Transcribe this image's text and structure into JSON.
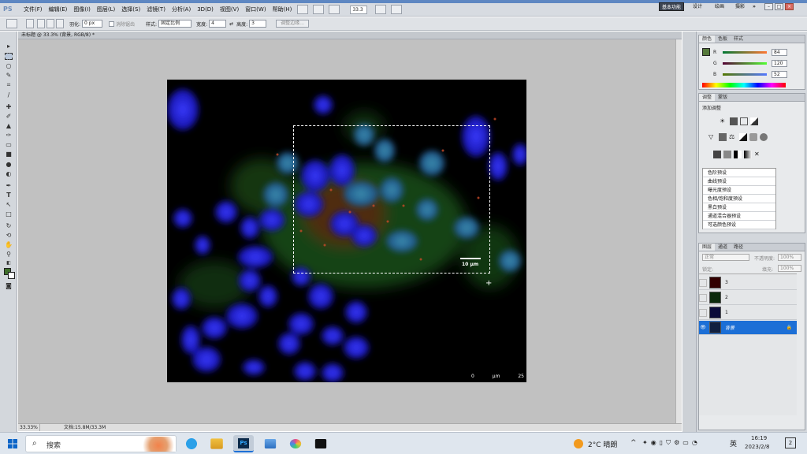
{
  "app": {
    "logo": "PS"
  },
  "menu": {
    "items": [
      "文件(F)",
      "编辑(E)",
      "图像(I)",
      "图层(L)",
      "选择(S)",
      "滤镜(T)",
      "分析(A)",
      "3D(D)",
      "视图(V)",
      "窗口(W)",
      "帮助(H)"
    ],
    "zoom": "33.3"
  },
  "workspace": {
    "basic": "基本功能",
    "design": "设计",
    "draw": "绘画",
    "photo": "摄影",
    "more": "»"
  },
  "options": {
    "feather_label": "羽化:",
    "feather_value": "0 px",
    "antialias_label": "消除锯齿",
    "style_label": "样式:",
    "style_value": "固定比例",
    "width_label": "宽度:",
    "width_value": "4",
    "height_label": "高度:",
    "height_value": "3",
    "refine_label": "调整边缘..."
  },
  "document": {
    "tab_title": "未标题 @ 33.3% (背景, RGB/8) *",
    "zoom_status": "33.33%",
    "doc_status": "文档:15.8M/33.3M"
  },
  "image": {
    "scale_label": "10 μm",
    "axis_labels": [
      "0",
      "μm",
      "25"
    ]
  },
  "color_panel": {
    "tabs": [
      "颜色",
      "色板",
      "样式"
    ],
    "r_label": "R",
    "r_value": "84",
    "g_label": "G",
    "g_value": "120",
    "b_label": "B",
    "b_value": "52"
  },
  "adjust_panel": {
    "tabs": [
      "调整",
      "蒙版"
    ],
    "title": "添加调整",
    "presets": [
      "色阶预设",
      "曲线预设",
      "曝光度预设",
      "色相/饱和度预设",
      "黑白预设",
      "通道混合器预设",
      "可选颜色预设"
    ]
  },
  "layers_panel": {
    "tabs": [
      "图层",
      "通道",
      "路径"
    ],
    "mode": "正常",
    "opacity_label": "不透明度:",
    "opacity_value": "100%",
    "lock_label": "锁定:",
    "fill_label": "填充:",
    "fill_value": "100%",
    "layers": [
      "3",
      "2",
      "1",
      "背景"
    ]
  },
  "taskbar": {
    "search_placeholder": "搜索",
    "temp": "2°C 晴朗",
    "ime": "英",
    "time": "16:19",
    "date": "2023/2/8",
    "notifications": "2"
  },
  "colors": {
    "accent": "#1c6fd6",
    "foreground_swatch": "#3f6f2b",
    "weather": "#f29a1e"
  }
}
